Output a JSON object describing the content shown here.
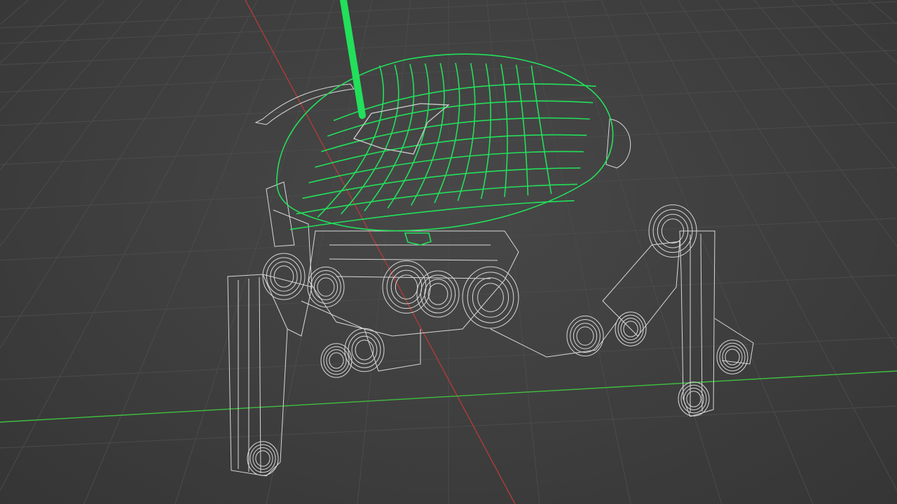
{
  "viewport": {
    "mode": "wireframe",
    "background": "#3d3d3d",
    "grid_color": "#4a4a4a",
    "x_axis_color": "#b03a3a",
    "y_axis_color": "#3fbf3f"
  },
  "object": {
    "selected_name": "dome",
    "selected_color": "#22e05a",
    "wire_color": "#d8d8d8"
  },
  "icons": {
    "gizmo": "z-axis-gizmo"
  }
}
